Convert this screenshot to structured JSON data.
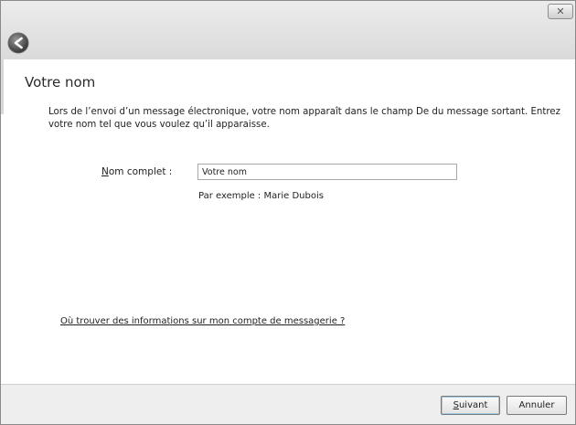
{
  "window": {
    "close_glyph": "✕"
  },
  "nav": {
    "back_icon": "back-arrow-icon"
  },
  "page": {
    "title": "Votre nom",
    "description": "Lors de l’envoi d’un message électronique, votre nom apparaît dans le champ De du message sortant. Entrez votre nom tel que vous voulez qu’il apparaisse."
  },
  "form": {
    "full_name_label_accesskey": "N",
    "full_name_label_rest": "om complet :",
    "full_name_value": "Votre nom",
    "example_text": "Par exemple : Marie Dubois"
  },
  "help": {
    "link_text": "Où trouver des informations sur mon compte de messagerie ?"
  },
  "footer": {
    "next_accesskey": "S",
    "next_rest": "uivant",
    "cancel_label": "Annuler"
  }
}
